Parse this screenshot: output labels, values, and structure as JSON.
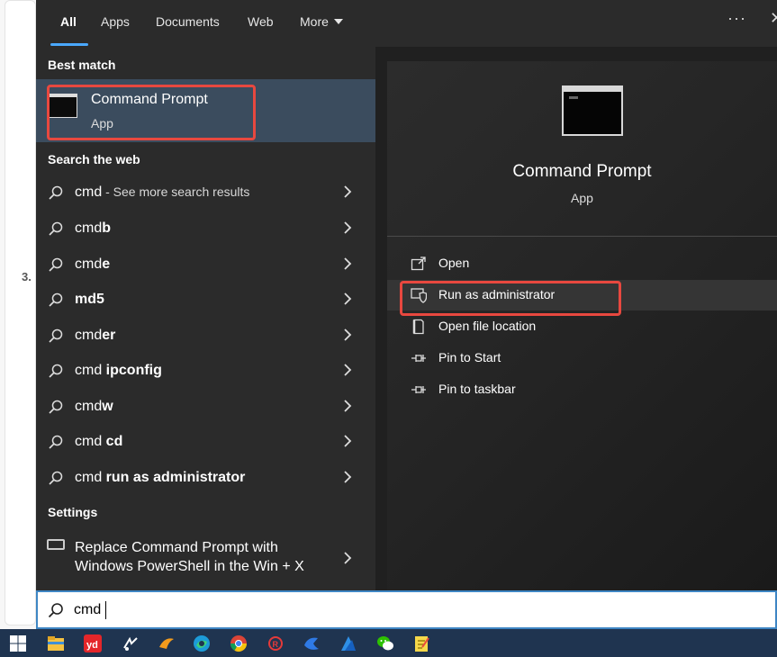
{
  "tabs": [
    {
      "label": "All",
      "active": true
    },
    {
      "label": "Apps"
    },
    {
      "label": "Documents"
    },
    {
      "label": "Web"
    },
    {
      "label": "More"
    }
  ],
  "top_actions": {
    "more_options": "···"
  },
  "left": {
    "best_match_heading": "Best match",
    "best_match": {
      "title": "Command Prompt",
      "subtitle": "App"
    },
    "web_heading": "Search the web",
    "web_results": [
      {
        "prefix": "cmd",
        "bold": "",
        "suffix": " - See more search results"
      },
      {
        "prefix": "cmd",
        "bold": "b",
        "suffix": ""
      },
      {
        "prefix": "cmd",
        "bold": "e",
        "suffix": ""
      },
      {
        "prefix": "",
        "bold": "md5",
        "suffix": ""
      },
      {
        "prefix": "cmd",
        "bold": "er",
        "suffix": ""
      },
      {
        "prefix": "cmd ",
        "bold": "ipconfig",
        "suffix": ""
      },
      {
        "prefix": "cmd",
        "bold": "w",
        "suffix": ""
      },
      {
        "prefix": "cmd ",
        "bold": "cd",
        "suffix": ""
      },
      {
        "prefix": "cmd ",
        "bold": "run as administrator",
        "suffix": ""
      }
    ],
    "settings_heading": "Settings",
    "setting_item": {
      "line1": "Replace Command Prompt with",
      "line2": "Windows PowerShell in the Win + X"
    }
  },
  "right": {
    "title": "Command Prompt",
    "subtitle": "App",
    "actions": [
      "Open",
      "Run as administrator",
      "Open file location",
      "Pin to Start",
      "Pin to taskbar"
    ]
  },
  "search": {
    "value": "cmd"
  },
  "background": {
    "step_number": "3."
  },
  "colors": {
    "accent": "#4aa8ff",
    "highlight_box": "#e8483f",
    "taskbar": "#1f3450"
  },
  "taskbar_icons": [
    "windows-start-icon",
    "file-explorer-icon",
    "youdao-icon",
    "app-icon",
    "app-icon",
    "edge-icon",
    "chrome-icon",
    "app-icon",
    "app-icon",
    "app-icon",
    "wechat-icon",
    "notes-icon"
  ]
}
